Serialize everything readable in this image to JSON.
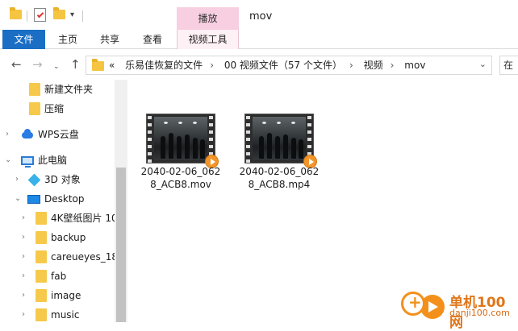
{
  "window": {
    "title": "mov",
    "context_tab": "播放"
  },
  "ribbon": {
    "tabs": [
      {
        "label": "文件"
      },
      {
        "label": "主页"
      },
      {
        "label": "共享"
      },
      {
        "label": "查看"
      },
      {
        "label": "视频工具"
      }
    ]
  },
  "address": {
    "overflow": "«",
    "crumbs": [
      "乐易佳恢复的文件",
      "00 视频文件（57 个文件）",
      "视频",
      "mov"
    ],
    "search_partial": "在"
  },
  "nav": {
    "items": [
      {
        "label": "新建文件夹",
        "icon": "folder-icon"
      },
      {
        "label": "压缩",
        "icon": "folder-icon"
      },
      {
        "label": "WPS云盘",
        "icon": "cloud-icon"
      },
      {
        "label": "此电脑",
        "icon": "computer-icon"
      },
      {
        "label": "3D 对象",
        "icon": "cube-icon"
      },
      {
        "label": "Desktop",
        "icon": "desktop-icon"
      },
      {
        "label": "4K壁纸图片 10",
        "icon": "folder-icon"
      },
      {
        "label": "backup",
        "icon": "folder-icon"
      },
      {
        "label": "careueyes_18",
        "icon": "folder-icon"
      },
      {
        "label": "fab",
        "icon": "folder-icon"
      },
      {
        "label": "image",
        "icon": "folder-icon"
      },
      {
        "label": "music",
        "icon": "folder-icon"
      }
    ]
  },
  "files": [
    {
      "name": "2040-02-06_0628_ACB8.mov"
    },
    {
      "name": "2040-02-06_0628_ACB8.mp4"
    }
  ],
  "watermark": {
    "title": "单机100网",
    "url": "danji100.com"
  },
  "colors": {
    "accent": "#1a6fc5",
    "context_tab": "#f7cfe0",
    "folder": "#f6c94a",
    "watermark": "#f3901b"
  }
}
